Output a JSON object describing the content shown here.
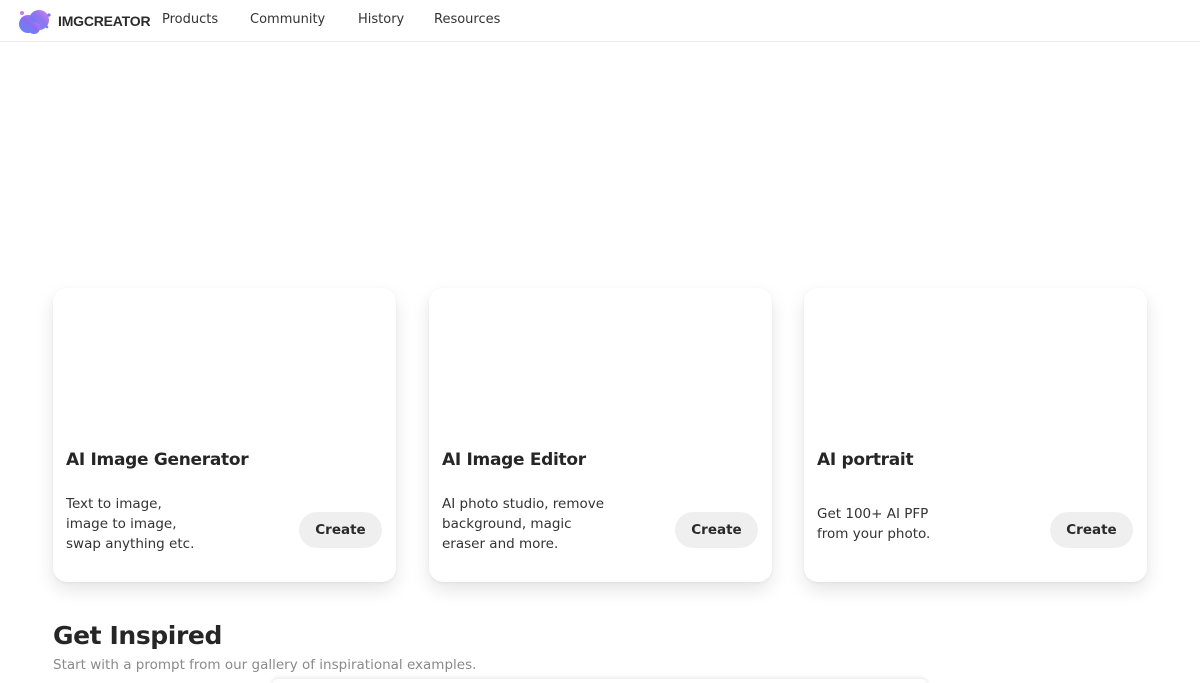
{
  "brand": {
    "name": "IMGCREATOR",
    "logo_icon": "blob-logo-icon"
  },
  "nav": {
    "items": [
      {
        "label": "Products"
      },
      {
        "label": "Community"
      },
      {
        "label": "History"
      },
      {
        "label": "Resources"
      }
    ]
  },
  "cards": [
    {
      "title": "AI Image Generator",
      "description": "Text to image,\nimage to image,\nswap anything etc.",
      "button": "Create"
    },
    {
      "title": "AI Image Editor",
      "description": "AI photo studio, remove\nbackground, magic\neraser and more.",
      "button": "Create"
    },
    {
      "title": "AI portrait",
      "description": "Get 100+ AI PFP\nfrom your photo.",
      "button": "Create"
    }
  ],
  "inspired": {
    "title": "Get Inspired",
    "subtitle": "Start with a prompt from our gallery of inspirational examples."
  },
  "colors": {
    "logo_gradient": [
      "#5b8cf5",
      "#8a6cf0",
      "#c77df2"
    ],
    "button_bg": "#efefef",
    "text_dark": "#262626",
    "text_muted": "#8a8a8a"
  }
}
